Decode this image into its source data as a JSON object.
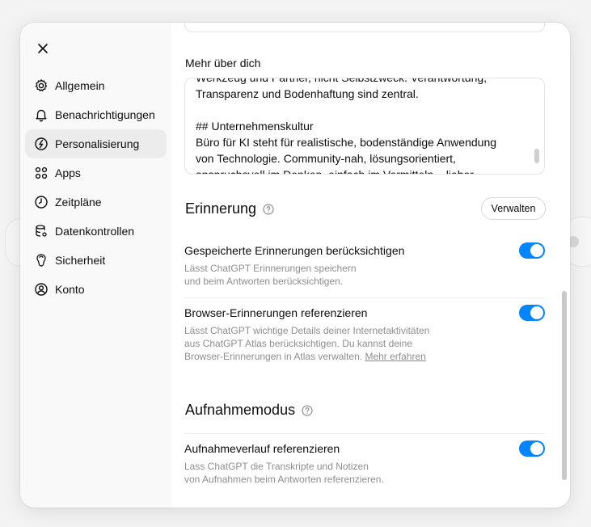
{
  "sidebar": {
    "items": [
      {
        "label": "Allgemein",
        "icon": "gear-icon"
      },
      {
        "label": "Benachrichtigungen",
        "icon": "bell-icon"
      },
      {
        "label": "Personalisierung",
        "icon": "personalization-icon"
      },
      {
        "label": "Apps",
        "icon": "apps-grid-icon"
      },
      {
        "label": "Zeitpläne",
        "icon": "clock-icon"
      },
      {
        "label": "Datenkontrollen",
        "icon": "database-icon"
      },
      {
        "label": "Sicherheit",
        "icon": "security-icon"
      },
      {
        "label": "Konto",
        "icon": "user-icon"
      }
    ],
    "active_index": 2
  },
  "about": {
    "label": "Mehr über dich",
    "text": "Werkzeug und Partner, nicht Selbstzweck. Verantwortung,\nTransparenz und Bodenhaftung sind zentral.\n\n## Unternehmenskultur\nBüro für KI steht für realistische, bodenständige Anwendung\nvon Technologie. Community-nah, lösungsorientiert,\nanspruchsvoll im Denken, einfach im Vermitteln – lieber"
  },
  "memory": {
    "title": "Erinnerung",
    "manage_label": "Verwalten",
    "settings": [
      {
        "title": "Gespeicherte Erinnerungen berücksichtigen",
        "desc": "Lässt ChatGPT Erinnerungen speichern\nund beim Antworten berücksichtigen.",
        "enabled": true
      },
      {
        "title": "Browser-Erinnerungen referenzieren",
        "desc": "Lässt ChatGPT wichtige Details deiner Internetaktivitäten\naus ChatGPT Atlas berücksichtigen. Du kannst deine\nBrowser-Erinnerungen in Atlas verwalten. ",
        "link": "Mehr erfahren",
        "enabled": true
      }
    ]
  },
  "recording": {
    "title": "Aufnahmemodus",
    "settings": [
      {
        "title": "Aufnahmeverlauf referenzieren",
        "desc": "Lass ChatGPT die Transkripte und Notizen\nvon Aufnahmen beim Antworten referenzieren.",
        "enabled": true
      }
    ]
  },
  "colors": {
    "toggle_on": "#0285ff",
    "active_nav": "#ececec"
  }
}
